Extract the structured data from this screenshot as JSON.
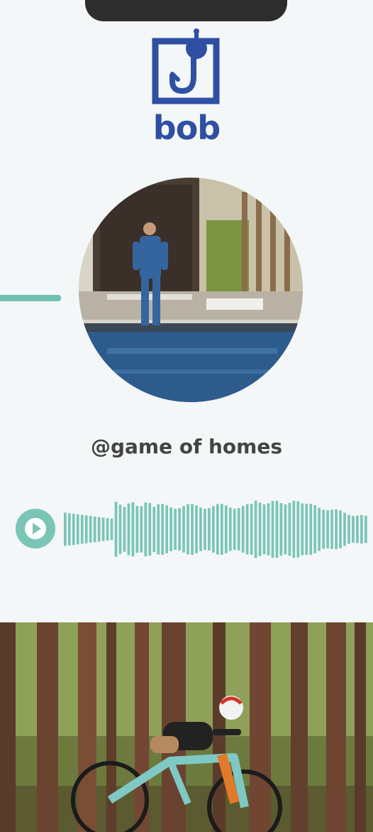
{
  "brand": {
    "logo_text": "bob",
    "logo_color": "#2f4fa3",
    "logo_icon": "fishhook-icon"
  },
  "profile": {
    "handle": "@game of homes",
    "avatar": "man-in-suit-by-pool-photo"
  },
  "audio": {
    "play_icon": "play-icon",
    "accent_color": "#7ac5b6"
  },
  "hero": {
    "image": "mountain-biker-in-forest-photo"
  }
}
